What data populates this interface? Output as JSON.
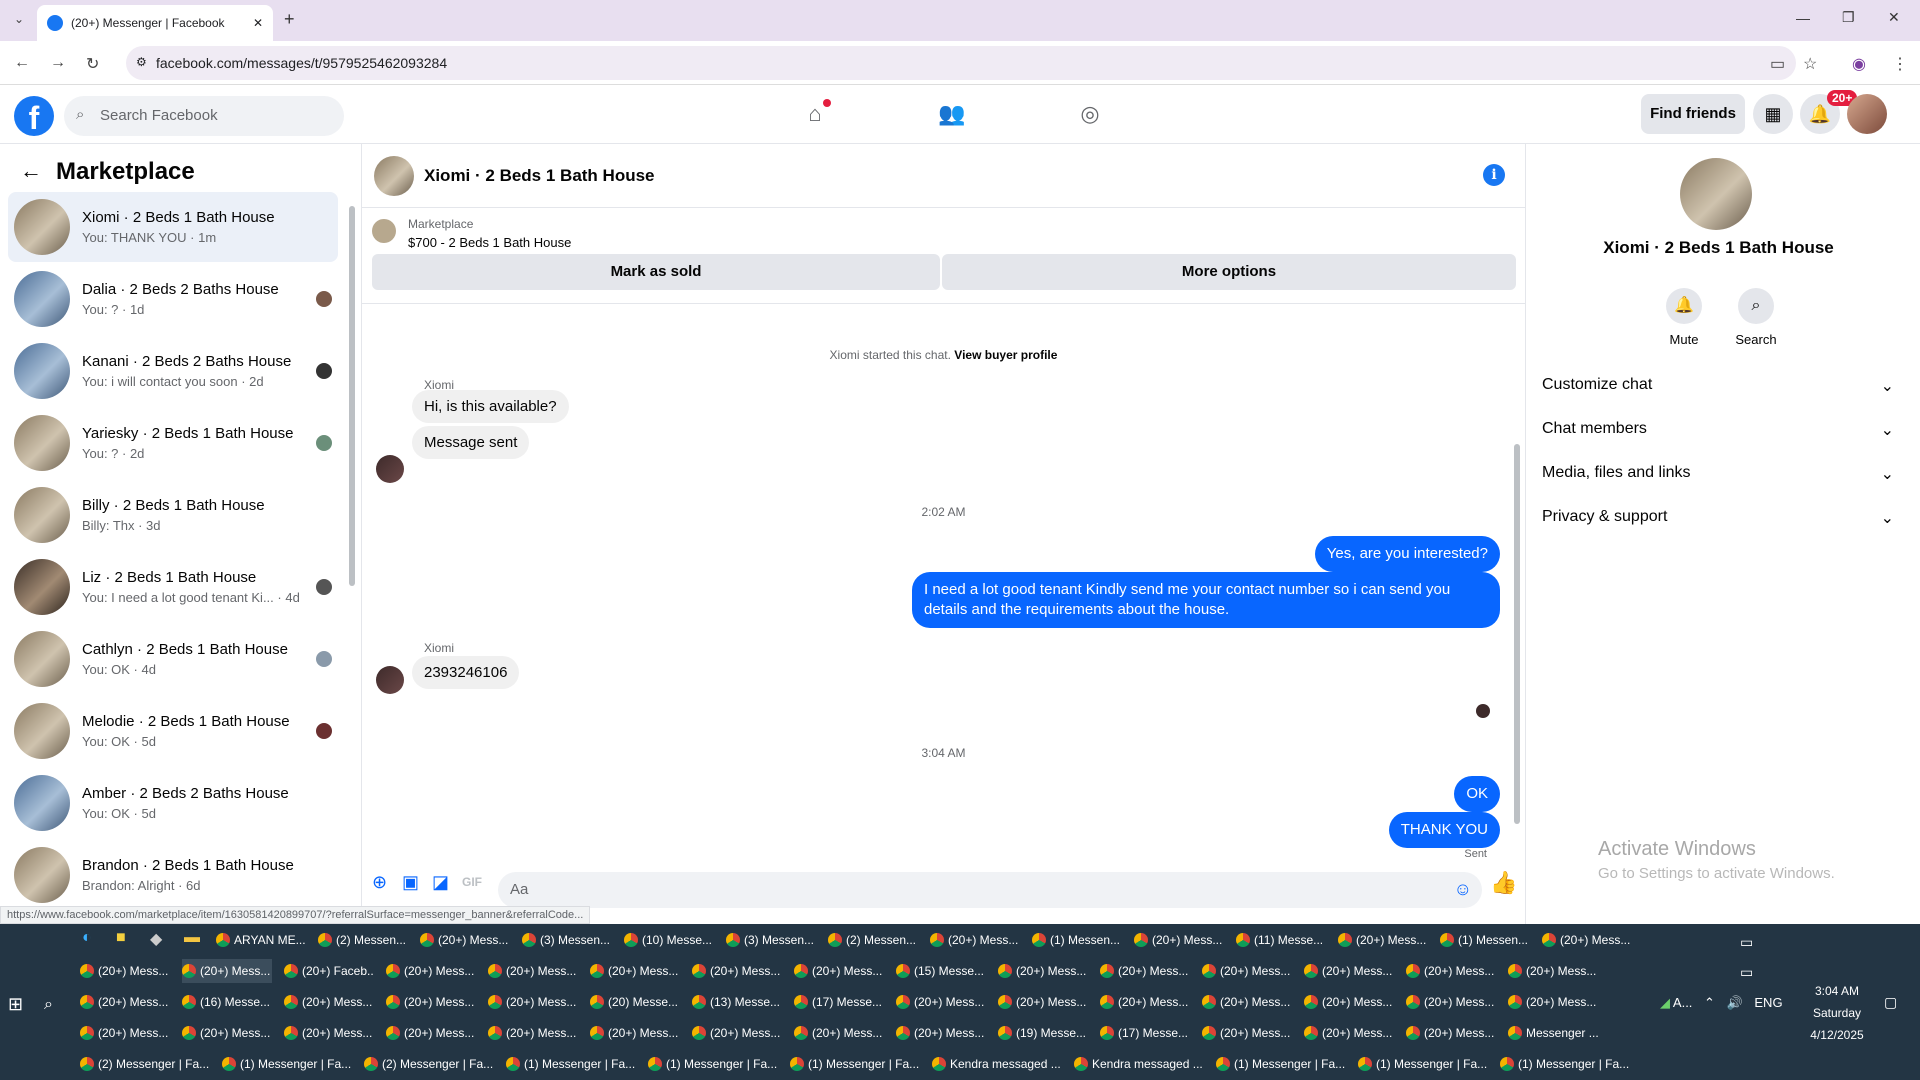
{
  "browser": {
    "tab_title": "(20+) Messenger | Facebook",
    "url": "facebook.com/messages/t/9579525462093284",
    "status_url": "https://www.facebook.com/marketplace/item/1630581420899707/?referralSurface=messenger_banner&referralCode..."
  },
  "header": {
    "search_placeholder": "Search Facebook",
    "find_friends": "Find friends",
    "notif_badge": "20+"
  },
  "sidebar": {
    "title": "Marketplace",
    "conversations": [
      {
        "name": "Xiomi · 2 Beds 1 Bath House",
        "snippet": "You: THANK YOU · 1m"
      },
      {
        "name": "Dalia · 2 Beds 2 Baths House",
        "snippet": "You: ? · 1d"
      },
      {
        "name": "Kanani · 2 Beds 2 Baths House",
        "snippet": "You: i will contact you soon · 2d"
      },
      {
        "name": "Yariesky · 2 Beds 1 Bath House",
        "snippet": "You: ? · 2d"
      },
      {
        "name": "Billy · 2 Beds 1 Bath House",
        "snippet": "Billy: Thx · 3d"
      },
      {
        "name": "Liz · 2 Beds 1 Bath House",
        "snippet": "You: I need a lot good tenant Ki... · 4d"
      },
      {
        "name": "Cathlyn · 2 Beds 1 Bath House",
        "snippet": "You: OK · 4d"
      },
      {
        "name": "Melodie · 2 Beds 1 Bath House",
        "snippet": "You: OK · 5d"
      },
      {
        "name": "Amber · 2 Beds 2 Baths House",
        "snippet": "You: OK · 5d"
      },
      {
        "name": "Brandon · 2 Beds 1 Bath House",
        "snippet": "Brandon: Alright · 6d"
      }
    ]
  },
  "chat": {
    "title": "Xiomi · 2 Beds 1 Bath House",
    "marketplace_label": "Marketplace",
    "listing": "$700 - 2 Beds 1 Bath House",
    "mark_sold": "Mark as sold",
    "more_options": "More options",
    "started_text": "Xiomi started this chat.",
    "view_profile": "View buyer profile",
    "sender1": "Xiomi",
    "msg1": "Hi, is this available?",
    "msg2": "Message sent",
    "time1": "2:02 AM",
    "msg3": "Yes, are you interested?",
    "msg4": "I need a lot good tenant Kindly send me your contact number so i can send you details and the requirements about the house.",
    "sender2": "Xiomi",
    "msg5": "2393246106",
    "time2": "3:04 AM",
    "msg6": "OK",
    "msg7": "THANK YOU",
    "sent_label": "Sent",
    "composer_placeholder": "Aa"
  },
  "right_pane": {
    "name": "Xiomi · 2 Beds 1 Bath House",
    "mute": "Mute",
    "search": "Search",
    "sections": [
      "Customize chat",
      "Chat members",
      "Media, files and links",
      "Privacy & support"
    ]
  },
  "watermark": {
    "line1": "Activate Windows",
    "line2": "Go to Settings to activate Windows."
  },
  "taskbar": {
    "row1": [
      "ARYAN ME...",
      "(2) Messen...",
      "(20+) Mess...",
      "(3) Messen...",
      "(10) Messe...",
      "(3) Messen...",
      "(2) Messen...",
      "(20+) Mess...",
      "(1) Messen...",
      "(20+) Mess...",
      "(11) Messe...",
      "(20+) Mess...",
      "(1) Messen...",
      "(20+) Mess..."
    ],
    "row2": [
      "(20+) Mess...",
      "(20+) Mess...",
      "(20+) Faceb...",
      "(20+) Mess...",
      "(20+) Mess...",
      "(20+) Mess...",
      "(20+) Mess...",
      "(20+) Mess...",
      "(15) Messe...",
      "(20+) Mess...",
      "(20+) Mess...",
      "(20+) Mess...",
      "(20+) Mess...",
      "(20+) Mess...",
      "(20+) Mess..."
    ],
    "row3": [
      "(20+) Mess...",
      "(16) Messe...",
      "(20+) Mess...",
      "(20+) Mess...",
      "(20+) Mess...",
      "(20) Messe...",
      "(13) Messe...",
      "(17) Messe...",
      "(20+) Mess...",
      "(20+) Mess...",
      "(20+) Mess...",
      "(20+) Mess...",
      "(20+) Mess...",
      "(20+) Mess...",
      "(20+) Mess..."
    ],
    "row4": [
      "(20+) Mess...",
      "(20+) Mess...",
      "(20+) Mess...",
      "(20+) Mess...",
      "(20+) Mess...",
      "(20+) Mess...",
      "(20+) Mess...",
      "(20+) Mess...",
      "(20+) Mess...",
      "(19) Messe...",
      "(17) Messe...",
      "(20+) Mess...",
      "(20+) Mess...",
      "(20+) Mess...",
      "Messenger ..."
    ],
    "row5": [
      "(2) Messenger | Fa...",
      "(1) Messenger | Fa...",
      "(2) Messenger | Fa...",
      "(1) Messenger | Fa...",
      "(1) Messenger | Fa...",
      "(1) Messenger | Fa...",
      "Kendra messaged ...",
      "Kendra messaged ...",
      "(1) Messenger | Fa...",
      "(1) Messenger | Fa...",
      "(1) Messenger | Fa..."
    ],
    "tray_a": "A...",
    "lang": "ENG",
    "time": "3:04 AM",
    "day": "Saturday",
    "date": "4/12/2025"
  }
}
